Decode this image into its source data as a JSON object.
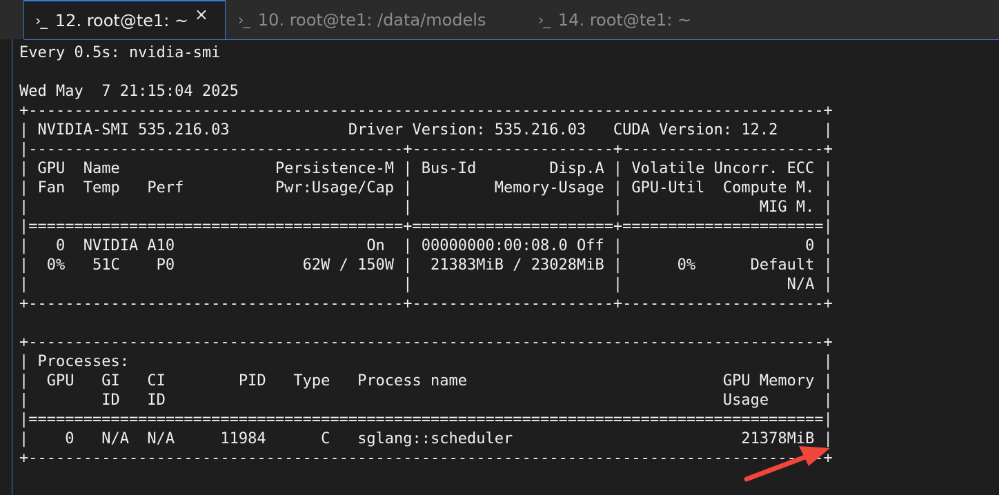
{
  "tabs": [
    {
      "icon": "terminal-prompt-icon",
      "label": "12. root@te1: ~",
      "active": true,
      "close": "×"
    },
    {
      "icon": "terminal-prompt-icon",
      "label": "10. root@te1: /data/models",
      "active": false
    },
    {
      "icon": "terminal-prompt-icon",
      "label": "14. root@te1: ~",
      "active": false
    }
  ],
  "prompt_glyph": "›_",
  "terminal": {
    "lines": [
      "Every 0.5s: nvidia-smi",
      "",
      "Wed May  7 21:15:04 2025",
      "+---------------------------------------------------------------------------------------+",
      "| NVIDIA-SMI 535.216.03             Driver Version: 535.216.03   CUDA Version: 12.2     |",
      "|-----------------------------------------+----------------------+----------------------+",
      "| GPU  Name                 Persistence-M | Bus-Id        Disp.A | Volatile Uncorr. ECC |",
      "| Fan  Temp   Perf          Pwr:Usage/Cap |         Memory-Usage | GPU-Util  Compute M. |",
      "|                                         |                      |               MIG M. |",
      "|=========================================+======================+======================|",
      "|   0  NVIDIA A10                     On  | 00000000:00:08.0 Off |                    0 |",
      "|  0%   51C    P0              62W / 150W |  21383MiB / 23028MiB |      0%      Default |",
      "|                                         |                      |                  N/A |",
      "+-----------------------------------------+----------------------+----------------------+",
      "",
      "+---------------------------------------------------------------------------------------+",
      "| Processes:                                                                            |",
      "|  GPU   GI   CI        PID   Type   Process name                            GPU Memory |",
      "|        ID   ID                                                             Usage      |",
      "|=======================================================================================|",
      "|    0   N/A  N/A     11984      C   sglang::scheduler                         21378MiB |",
      "+---------------------------------------------------------------------------------------+"
    ]
  },
  "annotation": {
    "color": "#f0463c",
    "icon": "red-arrow-icon"
  }
}
